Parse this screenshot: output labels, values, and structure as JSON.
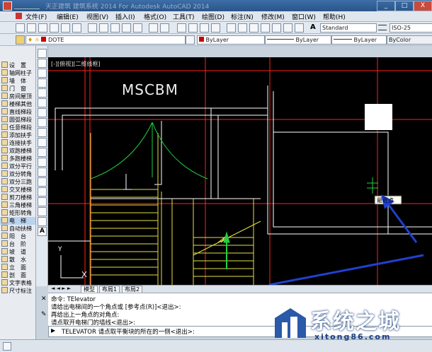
{
  "window": {
    "title": "天正建筑 建筑系统 2014  For Autodesk AutoCAD 2014",
    "controls": [
      "_",
      "□",
      "X"
    ]
  },
  "menu": [
    "文件(F)",
    "编辑(E)",
    "视图(V)",
    "插入(I)",
    "格式(O)",
    "工具(T)",
    "绘图(D)",
    "标注(N)",
    "修改(M)",
    "窗口(W)",
    "帮助(H)"
  ],
  "toolbar": {
    "text_style": "Standard",
    "dim_style": "ISO-25",
    "layer": "DOTE",
    "color": "ByLayer",
    "linetype": "ByLayer",
    "lineweight": "ByLayer",
    "plotstyle": "ByColor"
  },
  "left_panel": [
    "设　置",
    "轴网柱子",
    "墙　体",
    "门　窗",
    "房间屋顶",
    "楼梯其他",
    "直线梯段",
    "圆弧梯段",
    "任意梯段",
    "添加扶手",
    "连接扶手",
    "双跑楼梯",
    "多跑楼梯",
    "双分平行",
    "双分转角",
    "双分三跑",
    "交叉楼梯",
    "剪刀楼梯",
    "三角楼梯",
    "矩形转角",
    "电　梯",
    "自动扶梯",
    "阳　台",
    "台　阶",
    "坡　道",
    "散　水",
    "立　面",
    "剖　面",
    "文字表格",
    "尺寸标注"
  ],
  "canvas": {
    "view_label": "[-][俯视][二维线框]",
    "drawing_text": "MSCBM",
    "tooltip": "最近点"
  },
  "tabs": [
    "模型",
    "布局1",
    "布局2"
  ],
  "command": {
    "history": [
      "命令: TElevator",
      "请给出电梯间的一个角点或 [参考点(R)]<退出>:",
      "再给出上一角点的对角点:",
      "请点取开电梯门的墙线<退出>:"
    ],
    "prompt": "TELEVATOR 请点取平衡块的所在的一侧<退出>:"
  },
  "watermark": {
    "title": "系统之城",
    "url": "xitong86.com"
  },
  "colors": {
    "canvas_bg": "#000000",
    "wall": "#ffffff",
    "axis": "#ff2020",
    "stair": "#e8e040",
    "door": "#20d040",
    "arrow": "#2040d0"
  }
}
